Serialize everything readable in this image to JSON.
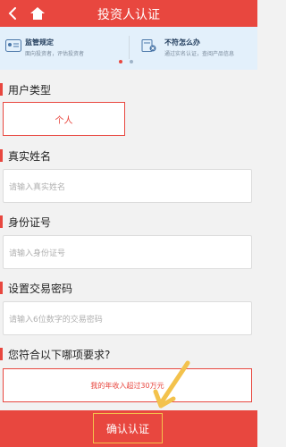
{
  "header": {
    "title": "投资人认证",
    "back_icon": "back-arrow-icon",
    "home_icon": "home-icon"
  },
  "banner": {
    "left": {
      "title": "监管规定",
      "subtitle": "面向投资者，评估投资者",
      "icon": "id-card-icon"
    },
    "right": {
      "title": "不符怎么办",
      "subtitle": "通过实名认证，查阅产品信息",
      "icon": "document-x-icon"
    },
    "dots": [
      "#e8473f",
      "#9fb4c8"
    ]
  },
  "user_type": {
    "label": "用户类型",
    "option": "个人"
  },
  "real_name": {
    "label": "真实姓名",
    "placeholder": "请输入真实姓名"
  },
  "id_number": {
    "label": "身份证号",
    "placeholder": "请输入身份证号"
  },
  "trade_password": {
    "label": "设置交易密码",
    "placeholder": "请输入6位数字的交易密码"
  },
  "requirement": {
    "label": "您符合以下哪项要求?",
    "option": "我的年收入超过30万元"
  },
  "footer": {
    "confirm_label": "确认认证"
  },
  "colors": {
    "accent": "#e8473f",
    "highlight": "#f3c24c"
  }
}
